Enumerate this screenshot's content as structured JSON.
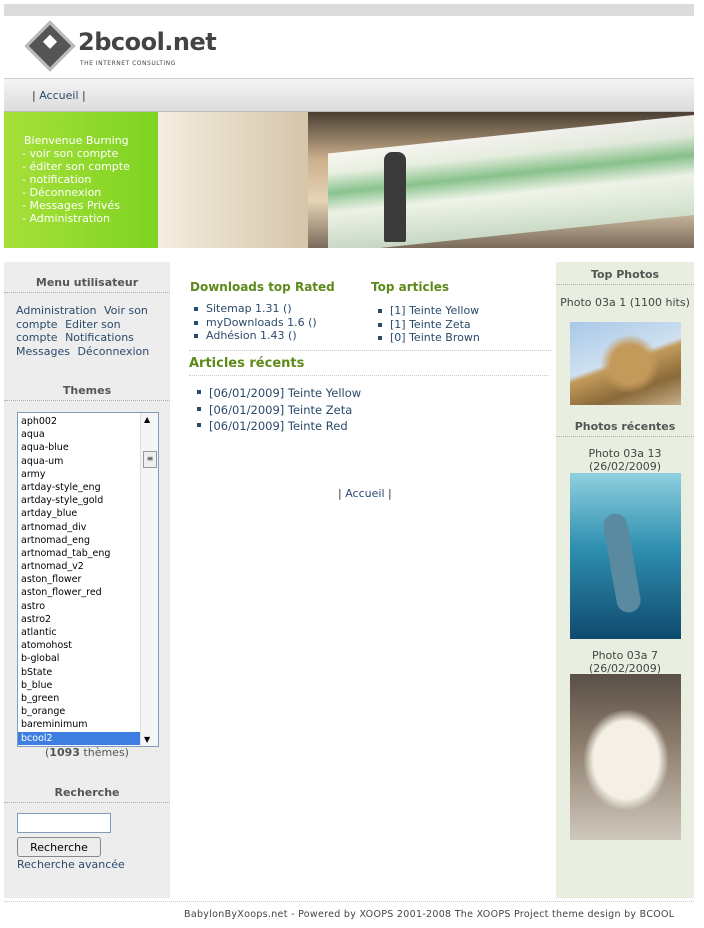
{
  "logo": {
    "name": "2bcool.net",
    "tagline": "THE INTERNET CONSULTING"
  },
  "nav": {
    "pre": "|",
    "home": "Accueil",
    "post": "|"
  },
  "welcome": {
    "greeting": "Bienvenue Burning",
    "items": [
      "- voir son compte",
      "- éditer son compte",
      "- notification",
      "- Déconnexion",
      "- Messages Privés",
      "- Administration"
    ]
  },
  "user_menu": {
    "title": "Menu utilisateur",
    "items": [
      "Administration",
      "Voir son compte",
      "Editer son compte",
      "Notifications",
      "Messages",
      "Déconnexion"
    ]
  },
  "themes": {
    "title": "Themes",
    "items": [
      "aph002",
      "aqua",
      "aqua-blue",
      "aqua-um",
      "army",
      "artday-style_eng",
      "artday-style_gold",
      "artday_blue",
      "artnomad_div",
      "artnomad_eng",
      "artnomad_tab_eng",
      "artnomad_v2",
      "aston_flower",
      "aston_flower_red",
      "astro",
      "astro2",
      "atlantic",
      "atomohost",
      "b-global",
      "bState",
      "b_blue",
      "b_green",
      "b_orange",
      "bareminimum",
      "bcool2"
    ],
    "selected": "bcool2",
    "count_open": "(",
    "count": "1093",
    "count_suffix": " thèmes)"
  },
  "search": {
    "title": "Recherche",
    "value": "",
    "button": "Recherche",
    "advanced": "Recherche avancée"
  },
  "downloads": {
    "title": "Downloads top Rated",
    "items": [
      "Sitemap 1.31 ()",
      "myDownloads 1.6 ()",
      "Adhésion 1.43 ()"
    ]
  },
  "top_articles": {
    "title": "Top articles",
    "items": [
      "[1] Teinte Yellow",
      "[1] Teinte Zeta",
      "[0] Teinte Brown"
    ]
  },
  "recent_articles": {
    "title": "Articles récents",
    "items": [
      "[06/01/2009] Teinte Yellow",
      "[06/01/2009] Teinte Zeta",
      "[06/01/2009] Teinte Red"
    ]
  },
  "center_nav": {
    "pre": "|",
    "home": "Accueil",
    "post": "|"
  },
  "top_photos": {
    "title": "Top Photos",
    "caption": "Photo 03a 1 (1100 hits)"
  },
  "recent_photos": {
    "title": "Photos récentes",
    "items": [
      {
        "caption": "Photo 03a 13 (26/02/2009)"
      },
      {
        "caption": "Photo 03a 7 (26/02/2009)"
      }
    ]
  },
  "footer": {
    "text": "BabylonByXoops.net - Powered by XOOPS 2001-2008 The XOOPS Project theme design by BCOOL"
  }
}
